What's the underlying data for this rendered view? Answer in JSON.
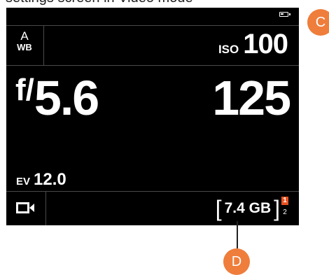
{
  "caption": "settings screen in Video mode",
  "camera_screen": {
    "white_balance": {
      "mode": "A",
      "label": "WB"
    },
    "iso": {
      "label": "ISO",
      "value": "100"
    },
    "aperture": {
      "prefix": "f/",
      "value": "5.6"
    },
    "shutter": {
      "value": "125"
    },
    "ev": {
      "label": "EV",
      "value": "12.0"
    },
    "storage": {
      "open_bracket": "[",
      "value": "7.4 GB",
      "close_bracket": "]",
      "slot_active": "1",
      "slot_inactive": "2"
    },
    "battery_level": 0.5
  },
  "callouts": {
    "c": "C",
    "d": "D"
  },
  "colors": {
    "screen_bg": "#000000",
    "accent": "#e8511f",
    "callout": "#ef7d3b"
  }
}
